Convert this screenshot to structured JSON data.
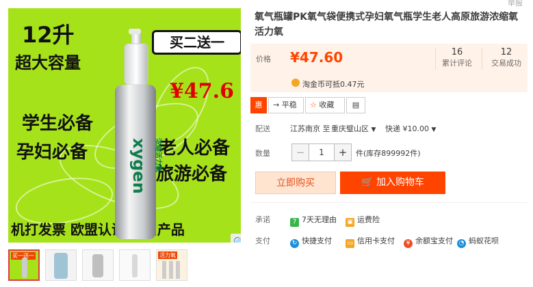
{
  "corner_text": "举报",
  "image": {
    "capacity": "12升",
    "capacity_sub": "超大容量",
    "promo": "买二送一",
    "price": "¥47.6",
    "tag_students": "学生必备",
    "tag_pregnant": "孕妇必备",
    "tag_elderly": "老人必备",
    "tag_travel": "旅游必备",
    "footer": "机打发票 欧盟认证 出口产品",
    "brand_text": "xygen",
    "bottle_cn": "浓缩活力氧",
    "bg_color": "#a6e21a"
  },
  "thumbnails": [
    {
      "selected": true,
      "caption": "买一送一"
    },
    {
      "selected": false,
      "caption": ""
    },
    {
      "selected": false,
      "caption": ""
    },
    {
      "selected": false,
      "caption": ""
    },
    {
      "selected": false,
      "caption": "活力氧"
    }
  ],
  "product": {
    "title": "氧气瓶罐PK氧气袋便携式孕妇氧气瓶学生老人高原旅游浓缩氧活力氧"
  },
  "price": {
    "label": "价格",
    "value": "¥47.60",
    "reviews_count": "16",
    "reviews_label": "累计评论",
    "sales_count": "12",
    "sales_label": "交易成功"
  },
  "coin": {
    "text": "淘金币可抵0.47元"
  },
  "chips": [
    {
      "icon": "惠",
      "label": ""
    },
    {
      "icon": "→",
      "label": "平稳"
    },
    {
      "icon": "☆",
      "label": "收藏"
    },
    {
      "icon": "▤",
      "label": ""
    }
  ],
  "delivery": {
    "label": "配送",
    "from": "江苏南京 至",
    "to": "重庆璧山区",
    "shipping": "快递 ¥10.00"
  },
  "quantity": {
    "label": "数量",
    "value": "1",
    "minus": "−",
    "plus": "+",
    "stock": "件(库存899992件)"
  },
  "buttons": {
    "buy_now": "立即购买",
    "add_cart": "加入购物车"
  },
  "promise": {
    "label": "承诺",
    "items": [
      "7天无理由",
      "运费险"
    ]
  },
  "payment": {
    "label": "支付",
    "items": [
      "快捷支付",
      "信用卡支付",
      "余额宝支付",
      "蚂蚁花呗"
    ]
  },
  "colors": {
    "accent": "#ff4400",
    "price": "#ff4400",
    "panel_bg": "#fff2e8"
  }
}
